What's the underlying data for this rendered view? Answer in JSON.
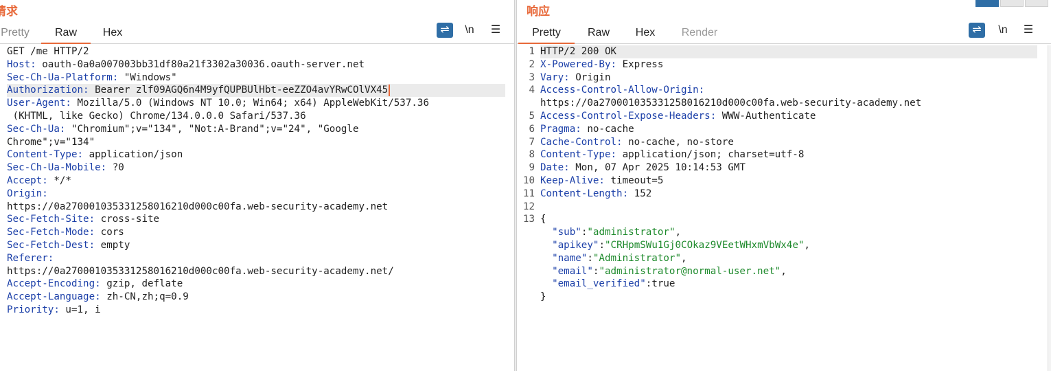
{
  "request": {
    "title": "请求",
    "tabs": [
      {
        "label": "Pretty",
        "active": false
      },
      {
        "label": "Raw",
        "active": true
      },
      {
        "label": "Hex",
        "active": false
      }
    ],
    "tools": {
      "newline": "\\n",
      "menu": "☰"
    },
    "lines": [
      {
        "k": "",
        "v": "GET /me HTTP/2"
      },
      {
        "k": "Host:",
        "v": " oauth-0a0a007003bb31df80a21f3302a30036.oauth-server.net"
      },
      {
        "k": "Sec-Ch-Ua-Platform:",
        "v": " \"Windows\""
      },
      {
        "k": "Authorization:",
        "v": " Bearer zlf09AGQ6n4M9yfQUPBUlHbt-eeZZO4avYRwCOlVX45",
        "highlight": true
      },
      {
        "k": "User-Agent:",
        "v": " Mozilla/5.0 (Windows NT 10.0; Win64; x64) AppleWebKit/537.36"
      },
      {
        "k": "",
        "v": " (KHTML, like Gecko) Chrome/134.0.0.0 Safari/537.36"
      },
      {
        "k": "Sec-Ch-Ua:",
        "v": " \"Chromium\";v=\"134\", \"Not:A-Brand\";v=\"24\", \"Google"
      },
      {
        "k": "",
        "v": "Chrome\";v=\"134\""
      },
      {
        "k": "Content-Type:",
        "v": " application/json"
      },
      {
        "k": "Sec-Ch-Ua-Mobile:",
        "v": " ?0"
      },
      {
        "k": "Accept:",
        "v": " */*"
      },
      {
        "k": "Origin:",
        "v": ""
      },
      {
        "k": "",
        "v": "https://0a27000103533125801621 0d000c00fa.web-security-academy.net"
      },
      {
        "k": "Sec-Fetch-Site:",
        "v": " cross-site"
      },
      {
        "k": "Sec-Fetch-Mode:",
        "v": " cors"
      },
      {
        "k": "Sec-Fetch-Dest:",
        "v": " empty"
      },
      {
        "k": "Referer:",
        "v": ""
      },
      {
        "k": "",
        "v": "https://0a27000103533125801621 0d000c00fa.web-security-academy.net/"
      },
      {
        "k": "Accept-Encoding:",
        "v": " gzip, deflate"
      },
      {
        "k": "Accept-Language:",
        "v": " zh-CN,zh;q=0.9"
      },
      {
        "k": "Priority:",
        "v": " u=1, i"
      }
    ]
  },
  "response": {
    "title": "响应",
    "tabs": [
      {
        "label": "Pretty",
        "active": true
      },
      {
        "label": "Raw",
        "active": false
      },
      {
        "label": "Hex",
        "active": false
      },
      {
        "label": "Render",
        "active": false,
        "disabled": true
      }
    ],
    "tools": {
      "newline": "\\n",
      "menu": "☰"
    },
    "line_numbers": [
      "1",
      "2",
      "3",
      "4",
      "",
      "5",
      "6",
      "7",
      "8",
      "9",
      "10",
      "11",
      "12",
      "13",
      "",
      "",
      "",
      "",
      "",
      ""
    ],
    "lines": [
      {
        "k": "",
        "v": "HTTP/2 200 OK",
        "highlight": true
      },
      {
        "k": "X-Powered-By:",
        "v": " Express"
      },
      {
        "k": "Vary:",
        "v": " Origin"
      },
      {
        "k": "Access-Control-Allow-Origin:",
        "v": ""
      },
      {
        "k": "",
        "v": "https://0a27000103533125801621 0d000c00fa.web-security-academy.net"
      },
      {
        "k": "Access-Control-Expose-Headers:",
        "v": " WWW-Authenticate"
      },
      {
        "k": "Pragma:",
        "v": " no-cache"
      },
      {
        "k": "Cache-Control:",
        "v": " no-cache, no-store"
      },
      {
        "k": "Content-Type:",
        "v": " application/json; charset=utf-8"
      },
      {
        "k": "Date:",
        "v": " Mon, 07 Apr 2025 10:14:53 GMT"
      },
      {
        "k": "Keep-Alive:",
        "v": " timeout=5"
      },
      {
        "k": "Content-Length:",
        "v": " 152"
      },
      {
        "k": "",
        "v": ""
      },
      {
        "k": "",
        "v": "{"
      },
      {
        "json_key": "\"sub\"",
        "json_val": "\"administrator\"",
        "tail": ","
      },
      {
        "json_key": "\"apikey\"",
        "json_val": "\"CRHpmSWu1Gj0COkaz9VEetWHxmVbWx4e\"",
        "tail": ","
      },
      {
        "json_key": "\"name\"",
        "json_val": "\"Administrator\"",
        "tail": ","
      },
      {
        "json_key": "\"email\"",
        "json_val": "\"administrator@normal-user.net\"",
        "tail": ","
      },
      {
        "json_key": "\"email_verified\"",
        "json_plain": "true",
        "tail": ""
      },
      {
        "k": "",
        "v": "}"
      }
    ]
  }
}
